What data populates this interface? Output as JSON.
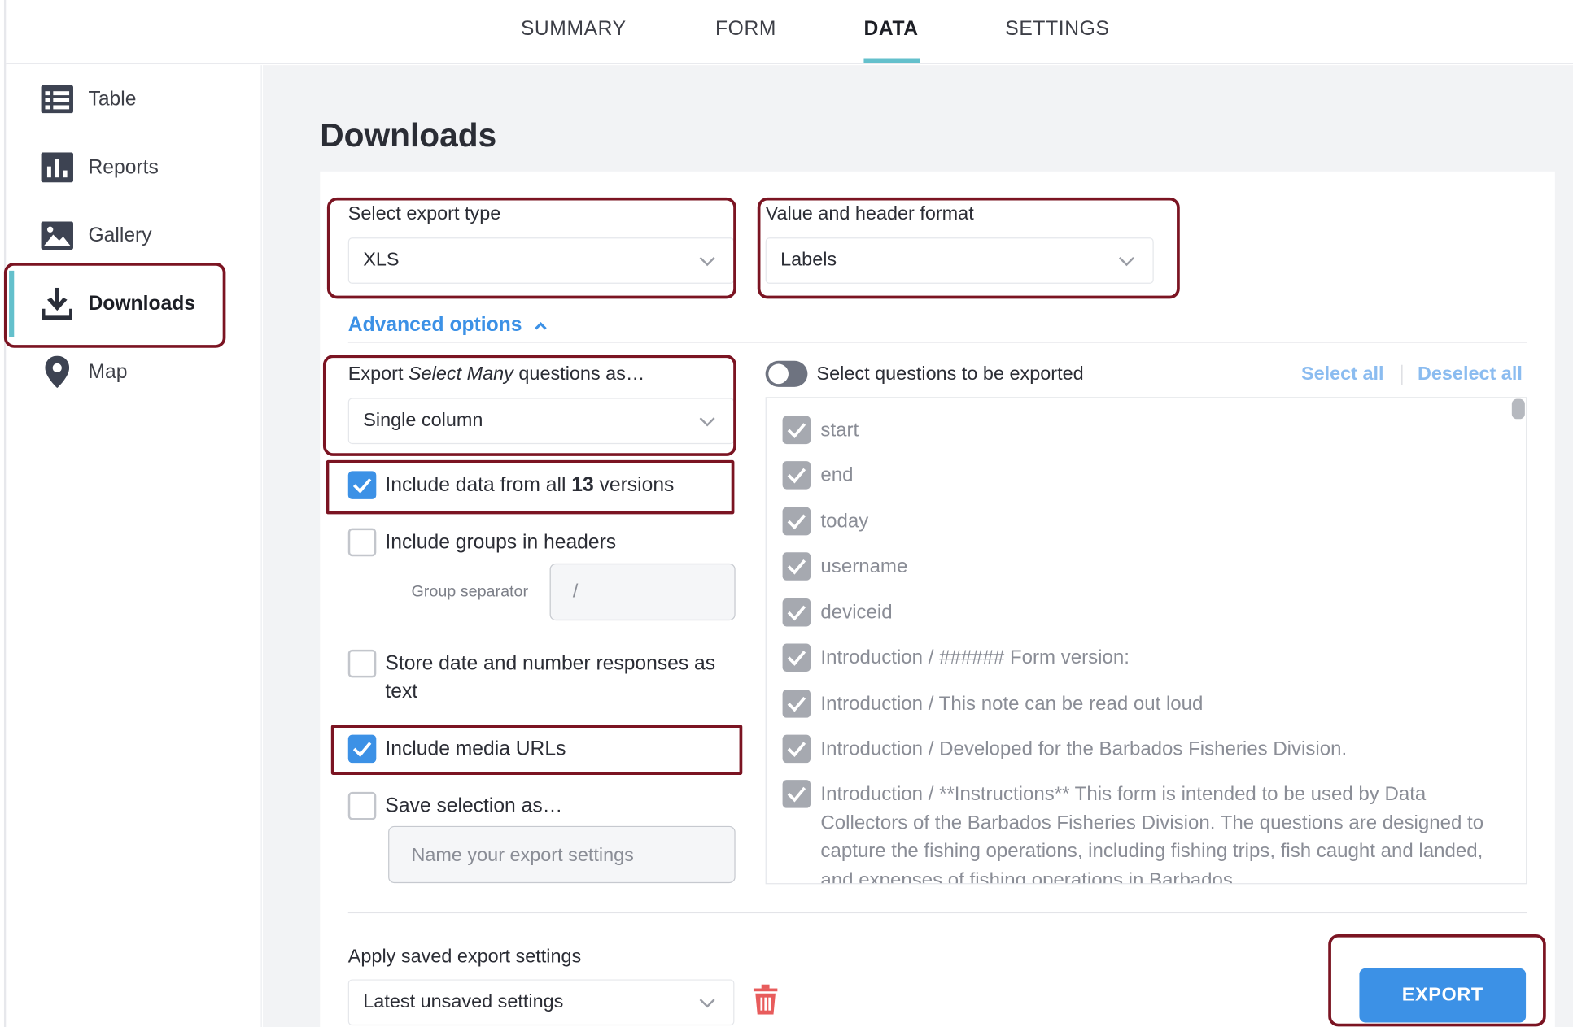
{
  "topnav": {
    "tabs": [
      {
        "label": "SUMMARY"
      },
      {
        "label": "FORM"
      },
      {
        "label": "DATA"
      },
      {
        "label": "SETTINGS"
      }
    ],
    "active_tab": "DATA"
  },
  "sidebar": {
    "items": [
      {
        "label": "Table",
        "icon": "table-icon"
      },
      {
        "label": "Reports",
        "icon": "bar-chart-icon"
      },
      {
        "label": "Gallery",
        "icon": "image-icon"
      },
      {
        "label": "Downloads",
        "icon": "download-icon"
      },
      {
        "label": "Map",
        "icon": "map-pin-icon"
      }
    ],
    "active_item": "Downloads"
  },
  "main": {
    "title": "Downloads",
    "export_type": {
      "label": "Select export type",
      "value": "XLS"
    },
    "header_format": {
      "label": "Value and header format",
      "value": "Labels"
    },
    "advanced_options": {
      "label": "Advanced options"
    },
    "select_many": {
      "label_pre": "Export ",
      "label_em": "Select Many",
      "label_post": " questions as…",
      "value": "Single column"
    },
    "include_versions": {
      "pre": "Include data from all ",
      "count": "13",
      "post": " versions",
      "checked": true
    },
    "include_groups": {
      "label": "Include groups in headers",
      "checked": false
    },
    "group_separator": {
      "label": "Group separator",
      "value": "/"
    },
    "store_as_text": {
      "label_line1": "Store date and number responses as",
      "label_line2": "text",
      "checked": false
    },
    "include_media": {
      "label": "Include media URLs",
      "checked": true
    },
    "save_selection": {
      "label": "Save selection as…",
      "checked": false,
      "placeholder": "Name your export settings"
    },
    "questions": {
      "toggle_label": "Select questions to be exported",
      "select_all": "Select all",
      "deselect_all": "Deselect all",
      "items": [
        "start",
        "end",
        "today",
        "username",
        "deviceid",
        "Introduction / ###### Form version:",
        "Introduction / This note can be read out loud",
        "Introduction / Developed for the Barbados Fisheries Division.",
        "Introduction / **Instructions** This form is intended to be used by Data Collectors of the Barbados Fisheries Division. The questions are designed to capture the fishing operations, including fishing trips, fish caught and landed, and expenses of fishing operations in Barbados."
      ]
    },
    "saved_settings": {
      "label": "Apply saved export settings",
      "value": "Latest unsaved settings"
    },
    "export_button": "EXPORT"
  },
  "colors": {
    "accent": "#3c91e6",
    "tab_underline": "#64c0cc",
    "highlight": "#7b1422",
    "trash": "#e85c5c"
  }
}
